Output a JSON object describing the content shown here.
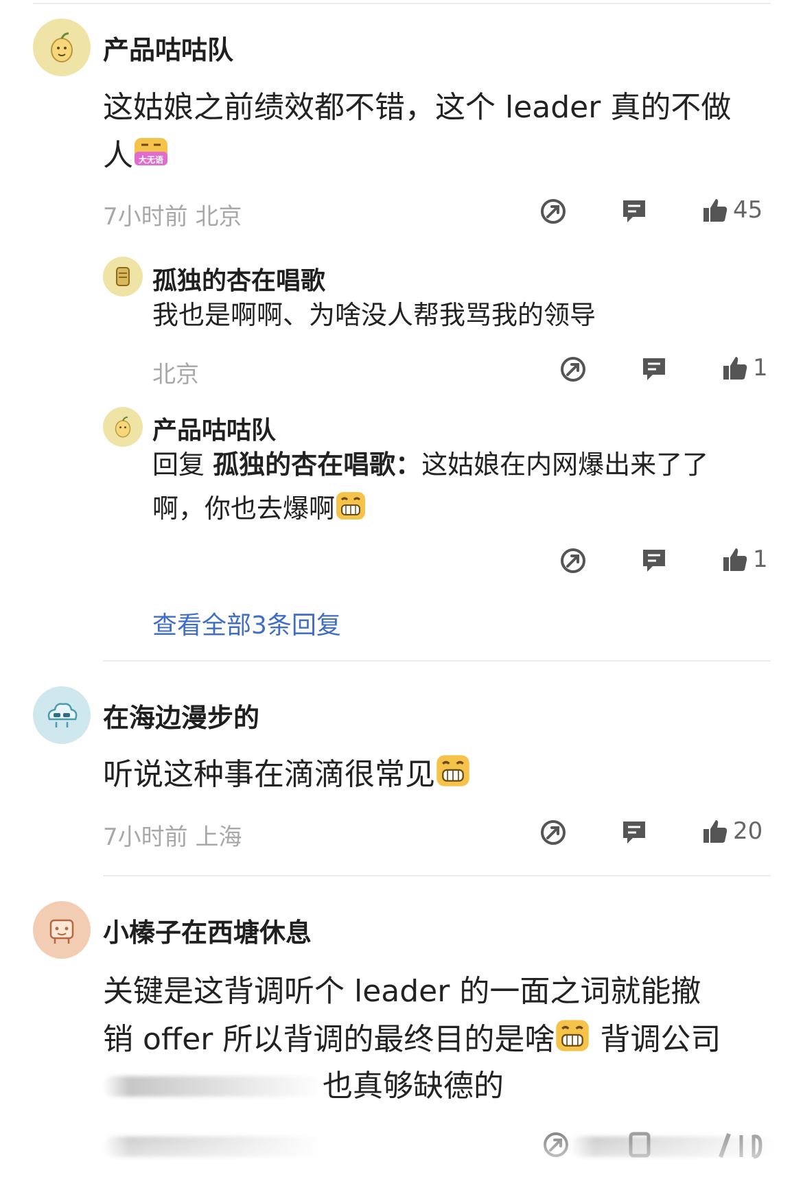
{
  "comments": [
    {
      "name": "产品咕咕队",
      "text": "这姑娘之前绩效都不错，这个 leader 真的不做人",
      "emoji": "大无语",
      "meta": "7小时前  北京",
      "likes": "45",
      "avatar_color": "#efe3a6",
      "replies": [
        {
          "name": "孤独的杏在唱歌",
          "text": "我也是啊啊、为啥没人帮我骂我的领导",
          "meta": "北京",
          "likes": "1"
        },
        {
          "name": "产品咕咕队",
          "reply_prefix": "回复 ",
          "reply_target": "孤独的杏在唱歌：",
          "text": "这姑娘在内网爆出来了了啊，你也去爆啊",
          "likes": "1"
        }
      ],
      "view_all": "查看全部3条回复"
    },
    {
      "name": "在海边漫步的",
      "text": "听说这种事在滴滴很常见",
      "meta": "7小时前  上海",
      "likes": "20",
      "avatar_color": "#cfe8ee"
    },
    {
      "name": "小榛子在西塘休息",
      "text_line1": "关键是这背调听个 leader 的一面之词就能撤",
      "text_line2a": "销 offer 所以背调的最终目的是啥",
      "text_line2b": " 背调公司",
      "text_line3": "也真够缺德的",
      "avatar_color": "#f2cdb4"
    }
  ],
  "colors": {
    "link": "#3f6ec9",
    "meta": "#a8a8a8",
    "icon": "#555555"
  },
  "icons": [
    "share-icon",
    "comment-icon",
    "thumbs-up-icon"
  ]
}
